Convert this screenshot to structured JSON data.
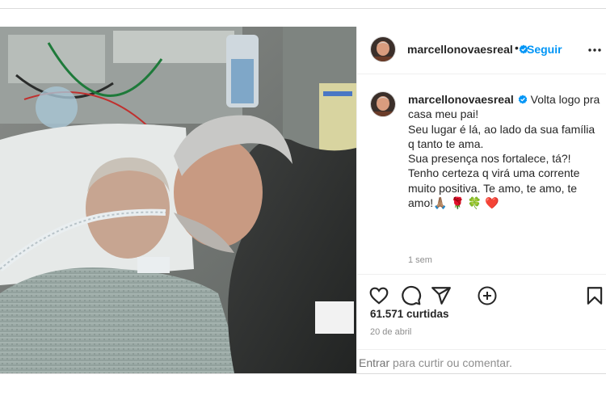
{
  "post": {
    "username": "marcellonovaesreal",
    "follow_label": "Seguir",
    "separator": "•",
    "caption_lines": [
      "Volta logo pra casa meu pai!",
      "Seu lugar é lá, ao lado da sua família q tanto te ama.",
      "Sua presença nos fortalece, tá?!",
      "Tenho certeza q virá uma corrente muito positiva. Te amo, te amo, te amo!🙏🏽 🌹 🍀 ❤️"
    ],
    "time_ago": "1 sem",
    "likes": "61.571 curtidas",
    "date": "20 de abril",
    "login_link": "Entrar",
    "login_text": " para curtir ou comentar."
  },
  "icons": {
    "verified": "verified-badge-icon",
    "more": "more-options-icon",
    "add_comment": "add-comment-icon",
    "like": "heart-icon",
    "comment": "comment-icon",
    "share": "share-icon",
    "save": "bookmark-icon"
  },
  "colors": {
    "link_blue": "#0095f6",
    "verified_blue": "#0095f6",
    "muted": "#8e8e8e",
    "divider": "#efefef"
  }
}
